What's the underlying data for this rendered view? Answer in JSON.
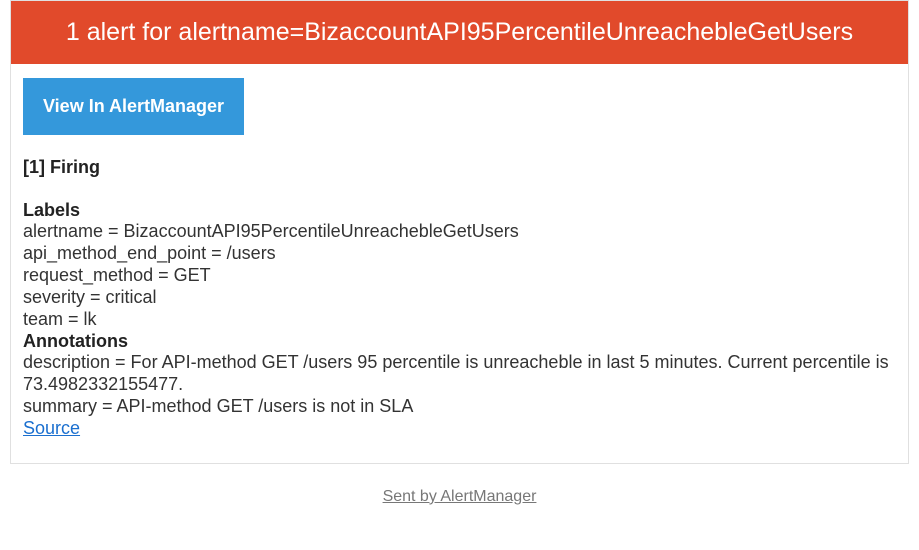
{
  "header": {
    "title": "1 alert for alertname=BizaccountAPI95PercentileUnreachebleGetUsers"
  },
  "button": {
    "view_label": "View In AlertManager"
  },
  "status": {
    "firing": "[1] Firing"
  },
  "labels": {
    "heading": "Labels",
    "items": [
      {
        "key": "alertname",
        "value": "BizaccountAPI95PercentileUnreachebleGetUsers"
      },
      {
        "key": "api_method_end_point",
        "value": "/users"
      },
      {
        "key": "request_method",
        "value": "GET"
      },
      {
        "key": "severity",
        "value": "critical"
      },
      {
        "key": "team",
        "value": "lk"
      }
    ]
  },
  "annotations": {
    "heading": "Annotations",
    "items": [
      {
        "key": "description",
        "value": "For API-method GET /users 95 percentile is unreacheble in last 5 minutes. Current percentile is 73.4982332155477."
      },
      {
        "key": "summary",
        "value": "API-method GET /users is not in SLA"
      }
    ]
  },
  "source": {
    "label": "Source"
  },
  "footer": {
    "label": "Sent by AlertManager"
  }
}
